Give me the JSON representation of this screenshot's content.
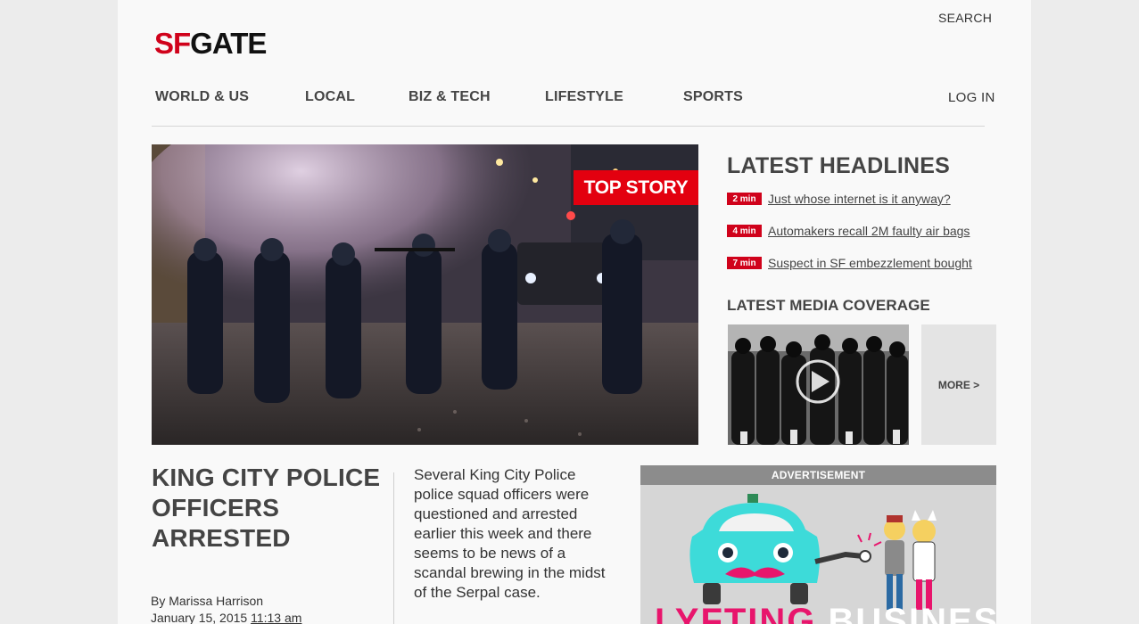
{
  "header": {
    "search_label": "SEARCH",
    "logo": {
      "sf": "SF",
      "gate": "GATE"
    },
    "login_label": "LOG IN"
  },
  "nav": {
    "items": [
      {
        "label": "WORLD & US"
      },
      {
        "label": "LOCAL"
      },
      {
        "label": "BIZ & TECH"
      },
      {
        "label": "LIFESTYLE"
      },
      {
        "label": "SPORTS"
      }
    ]
  },
  "hero": {
    "badge": "TOP STORY",
    "image_icon": "photo-police-line"
  },
  "latest": {
    "title": "LATEST HEADLINES",
    "items": [
      {
        "badge": "2 min",
        "text": "Just whose internet is it anyway?"
      },
      {
        "badge": "4 min",
        "text": "Automakers recall 2M faulty air bags"
      },
      {
        "badge": "7 min",
        "text": "Suspect in SF embezzlement bought"
      }
    ]
  },
  "media": {
    "title": "LATEST MEDIA COVERAGE",
    "more_label": "MORE >",
    "play_icon": "play-icon"
  },
  "story": {
    "headline": "KING CITY POLICE OFFICERS ARRESTED",
    "byline": "By Marissa Harrison",
    "date": "January 15, 2015",
    "time": "11:13 am",
    "summary": "Several King City Police police squad officers were questioned and arrested earlier this week and there seems to be news of a scandal brewing in the midst of the Serpal case."
  },
  "ad": {
    "label": "ADVERTISEMENT",
    "caption_pink": "LYFTING",
    "caption_white": "BUSINESS"
  },
  "colors": {
    "brand_red": "#d0021b",
    "badge_red": "#e3000f",
    "text_dark": "#444444",
    "ad_cyan": "#3ddbd9",
    "ad_pink": "#e8156c"
  }
}
